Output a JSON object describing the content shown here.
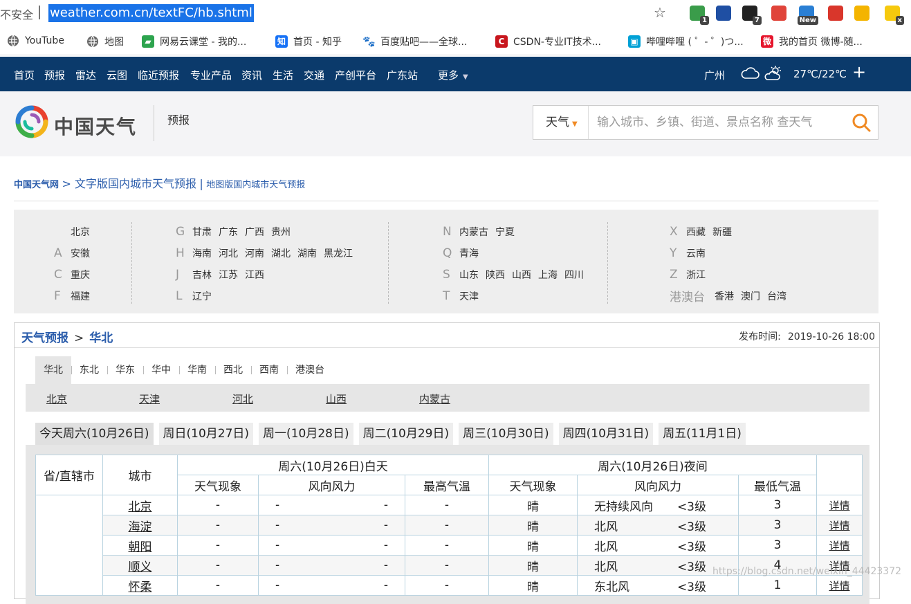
{
  "browser": {
    "insecure_label": "不安全",
    "url": "weather.com.cn/textFC/hb.shtml",
    "extensions": [
      {
        "name": "shield-ext",
        "badge": "1",
        "color": "#3a9c4a"
      },
      {
        "name": "y-ext",
        "badge": "",
        "color": "#1f4fa3"
      },
      {
        "name": "game-ext",
        "badge": "7",
        "color": "#222222"
      },
      {
        "name": "infinity-ext",
        "badge": "",
        "color": "#e0443a"
      },
      {
        "name": "new-ext",
        "badge": "New",
        "color": "#2a7fd4"
      },
      {
        "name": "bot-ext",
        "badge": "",
        "color": "#d9362b"
      },
      {
        "name": "chrome-ext",
        "badge": "",
        "color": "#f4b400"
      },
      {
        "name": "g-ext",
        "badge": "x",
        "color": "#f6c90e"
      }
    ]
  },
  "bookmarks": [
    {
      "label": "YouTube",
      "icon": "globe-icon"
    },
    {
      "label": "地图",
      "icon": "globe-icon"
    },
    {
      "label": "网易云课堂 - 我的...",
      "icon": "book-icon"
    },
    {
      "label": "首页 - 知乎",
      "icon": "zhihu-icon"
    },
    {
      "label": "百度贴吧——全球...",
      "icon": "paw-icon"
    },
    {
      "label": "CSDN-专业IT技术...",
      "icon": "csdn-icon"
    },
    {
      "label": "哔哩哔哩 ( ゜- ゜)つ...",
      "icon": "bilibili-icon"
    },
    {
      "label": "我的首页 微博-随...",
      "icon": "weibo-icon"
    }
  ],
  "nav": {
    "items": [
      "首页",
      "预报",
      "雷达",
      "云图",
      "临近预报",
      "专业产品",
      "资讯",
      "生活",
      "交通",
      "产创平台",
      "广东站"
    ],
    "more": "更多",
    "city": "广州",
    "temp": "27℃/22℃",
    "plus": "+"
  },
  "header": {
    "logo_text": "中国天气",
    "label": "预报",
    "search_type": "天气",
    "search_placeholder": "输入城市、乡镇、街道、景点名称 查天气"
  },
  "breadcrumb": {
    "home": "中国天气网",
    "text_version": "> 文字版国内城市天气预报",
    "sep": "|",
    "map_version": "地图版国内城市天气预报"
  },
  "provinces": {
    "col1": [
      {
        "letter": "",
        "items": [
          "北京"
        ]
      },
      {
        "letter": "A",
        "items": [
          "安徽"
        ]
      },
      {
        "letter": "C",
        "items": [
          "重庆"
        ]
      },
      {
        "letter": "F",
        "items": [
          "福建"
        ]
      }
    ],
    "col2": [
      {
        "letter": "G",
        "items": [
          "甘肃",
          "广东",
          "广西",
          "贵州"
        ]
      },
      {
        "letter": "H",
        "items": [
          "海南",
          "河北",
          "河南",
          "湖北",
          "湖南",
          "黑龙江"
        ]
      },
      {
        "letter": "J",
        "items": [
          "吉林",
          "江苏",
          "江西"
        ]
      },
      {
        "letter": "L",
        "items": [
          "辽宁"
        ]
      }
    ],
    "col3": [
      {
        "letter": "N",
        "items": [
          "内蒙古",
          "宁夏"
        ]
      },
      {
        "letter": "Q",
        "items": [
          "青海"
        ]
      },
      {
        "letter": "S",
        "items": [
          "山东",
          "陕西",
          "山西",
          "上海",
          "四川"
        ]
      },
      {
        "letter": "T",
        "items": [
          "天津"
        ]
      }
    ],
    "col4": [
      {
        "letter": "X",
        "items": [
          "西藏",
          "新疆"
        ]
      },
      {
        "letter": "Y",
        "items": [
          "云南"
        ]
      },
      {
        "letter": "Z",
        "items": [
          "浙江"
        ]
      },
      {
        "letter": "港澳台",
        "items": [
          "香港",
          "澳门",
          "台湾"
        ]
      }
    ]
  },
  "panel": {
    "title": "天气预报",
    "gt": ">",
    "region": "华北",
    "publish_label": "发布时间:",
    "publish_time": "2019-10-26 18:00",
    "region_tabs": [
      "华北",
      "东北",
      "华东",
      "华中",
      "华南",
      "西北",
      "西南",
      "港澳台"
    ],
    "sub_provinces": [
      "北京",
      "天津",
      "河北",
      "山西",
      "内蒙古"
    ],
    "day_tabs": [
      "今天周六(10月26日)",
      "周日(10月27日)",
      "周一(10月28日)",
      "周二(10月29日)",
      "周三(10月30日)",
      "周四(10月31日)",
      "周五(11月1日)"
    ]
  },
  "table": {
    "h_province": "省/直辖市",
    "h_city": "城市",
    "h_day": "周六(10月26日)白天",
    "h_night": "周六(10月26日)夜间",
    "h_phenom": "天气现象",
    "h_wind": "风向风力",
    "h_high": "最高气温",
    "h_phenom2": "天气现象",
    "h_wind2": "风向风力",
    "h_low": "最低气温",
    "rows": [
      {
        "city": "北京",
        "d_phen": "-",
        "d_wind": "-",
        "d_wlv": "-",
        "high": "-",
        "n_phen": "晴",
        "n_wind": "无持续风向",
        "n_wlv": "<3级",
        "low": "3",
        "detail": "详情"
      },
      {
        "city": "海淀",
        "d_phen": "-",
        "d_wind": "-",
        "d_wlv": "-",
        "high": "-",
        "n_phen": "晴",
        "n_wind": "北风",
        "n_wlv": "<3级",
        "low": "3",
        "detail": "详情"
      },
      {
        "city": "朝阳",
        "d_phen": "-",
        "d_wind": "-",
        "d_wlv": "-",
        "high": "-",
        "n_phen": "晴",
        "n_wind": "北风",
        "n_wlv": "<3级",
        "low": "3",
        "detail": "详情"
      },
      {
        "city": "顺义",
        "d_phen": "-",
        "d_wind": "-",
        "d_wlv": "-",
        "high": "-",
        "n_phen": "晴",
        "n_wind": "北风",
        "n_wlv": "<3级",
        "low": "4",
        "detail": "详情"
      },
      {
        "city": "怀柔",
        "d_phen": "-",
        "d_wind": "-",
        "d_wlv": "-",
        "high": "-",
        "n_phen": "晴",
        "n_wind": "东北风",
        "n_wlv": "<3级",
        "low": "1",
        "detail": "详情"
      }
    ]
  },
  "watermark": "https://blog.csdn.net/weixin_44423372"
}
